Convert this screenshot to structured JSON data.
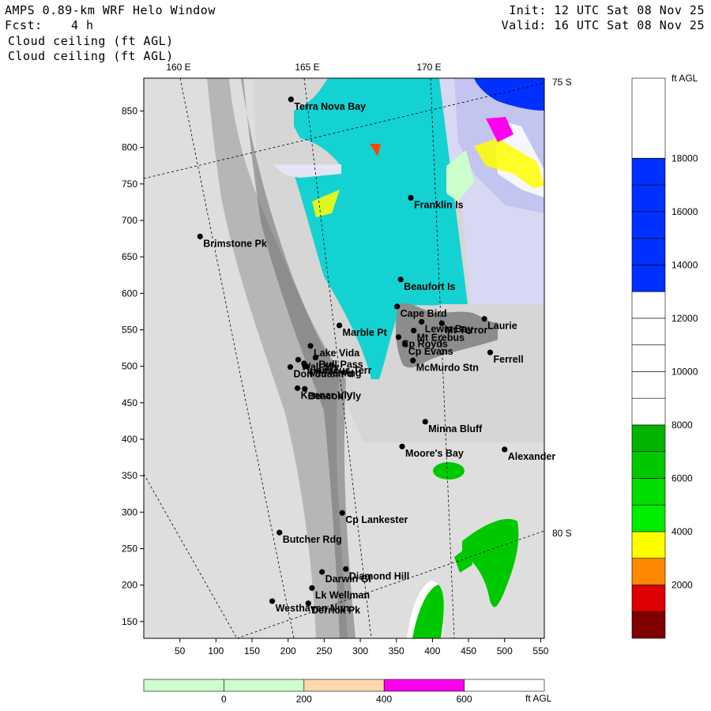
{
  "header": {
    "title": "AMPS 0.89-km WRF Helo Window",
    "fcst_label": "Fcst:",
    "fcst_value": "4 h",
    "field_1": "Cloud ceiling (ft AGL)",
    "field_2": "Cloud ceiling (ft AGL)",
    "init": "Init: 12 UTC Sat 08 Nov 25",
    "valid": "Valid: 16 UTC Sat 08 Nov 25"
  },
  "map": {
    "longitude_labels": [
      "160 E",
      "165 E",
      "170 E"
    ],
    "latitude_labels": [
      "75 S",
      "80 S"
    ],
    "x_ticks": [
      50,
      100,
      150,
      200,
      250,
      300,
      350,
      400,
      450,
      500,
      550
    ],
    "y_ticks": [
      150,
      200,
      250,
      300,
      350,
      400,
      450,
      500,
      550,
      600,
      650,
      700,
      750,
      800,
      850
    ],
    "x_range": [
      0,
      555
    ],
    "y_range": [
      127,
      895
    ],
    "places": [
      {
        "name": "Terra Nova Bay",
        "x": 204,
        "y": 866
      },
      {
        "name": "Franklin Is",
        "x": 370,
        "y": 731
      },
      {
        "name": "Brimstone Pk",
        "x": 78,
        "y": 678
      },
      {
        "name": "Beaufort Is",
        "x": 356,
        "y": 619
      },
      {
        "name": "Cape Bird",
        "x": 351,
        "y": 582
      },
      {
        "name": "Lewis Bay",
        "x": 385,
        "y": 561
      },
      {
        "name": "Laurie",
        "x": 472,
        "y": 565
      },
      {
        "name": "Marble Pt",
        "x": 271,
        "y": 556
      },
      {
        "name": "Mt Terror",
        "x": 413,
        "y": 559
      },
      {
        "name": "Mt Erebus",
        "x": 374,
        "y": 549
      },
      {
        "name": "Cp Royds",
        "x": 353,
        "y": 540
      },
      {
        "name": "Lake Vida",
        "x": 231,
        "y": 528
      },
      {
        "name": "Cp Evans",
        "x": 362,
        "y": 530
      },
      {
        "name": "Wall Vly",
        "x": 214,
        "y": 509
      },
      {
        "name": "Ferrell",
        "x": 480,
        "y": 519
      },
      {
        "name": "Bull Pass",
        "x": 238,
        "y": 512
      },
      {
        "name": "McMurdo Stn",
        "x": 373,
        "y": 508
      },
      {
        "name": "Don Juan Pd",
        "x": 203,
        "y": 499
      },
      {
        "name": "Mt Fleming",
        "x": 225,
        "y": 500
      },
      {
        "name": "Linnaeus Terr",
        "x": 222,
        "y": 504
      },
      {
        "name": "Kennar Vly",
        "x": 213,
        "y": 470
      },
      {
        "name": "Beacon Vly",
        "x": 223,
        "y": 469
      },
      {
        "name": "Minna Bluff",
        "x": 390,
        "y": 424
      },
      {
        "name": "Moore's Bay",
        "x": 358,
        "y": 390
      },
      {
        "name": "Alexander",
        "x": 500,
        "y": 386
      },
      {
        "name": "Cp Lankester",
        "x": 275,
        "y": 299
      },
      {
        "name": "Butcher Rdg",
        "x": 188,
        "y": 272
      },
      {
        "name": "Diamond Hill",
        "x": 280,
        "y": 222
      },
      {
        "name": "Darwin Gl",
        "x": 247,
        "y": 218
      },
      {
        "name": "Lk Wellman",
        "x": 233,
        "y": 196
      },
      {
        "name": "Westhaven Nun",
        "x": 178,
        "y": 178
      },
      {
        "name": "Derrick Pk",
        "x": 228,
        "y": 175
      }
    ]
  },
  "colorbar": {
    "unit": "ft AGL",
    "labels": [
      "18000",
      "16000",
      "14000",
      "12000",
      "10000",
      "8000",
      "6000",
      "4000",
      "2000"
    ],
    "colors": [
      "#800000",
      "#dd0000",
      "#ff8800",
      "#ffff00",
      "#00ee00",
      "#00dd00",
      "#00c800",
      "#00b400",
      "#ffffff",
      "#ffffff",
      "#ffffff",
      "#ffffff",
      "#ffffff",
      "#0030ff",
      "#0030ff",
      "#0030ff",
      "#0030ff",
      "#0030ff"
    ]
  },
  "bottom_bar": {
    "unit": "ft AGL",
    "labels": [
      "0",
      "200",
      "400",
      "600"
    ],
    "colors": [
      "#ccffcc",
      "#ccffcc",
      "#ffd8b0",
      "#ff00ee",
      "#ffffff"
    ]
  }
}
